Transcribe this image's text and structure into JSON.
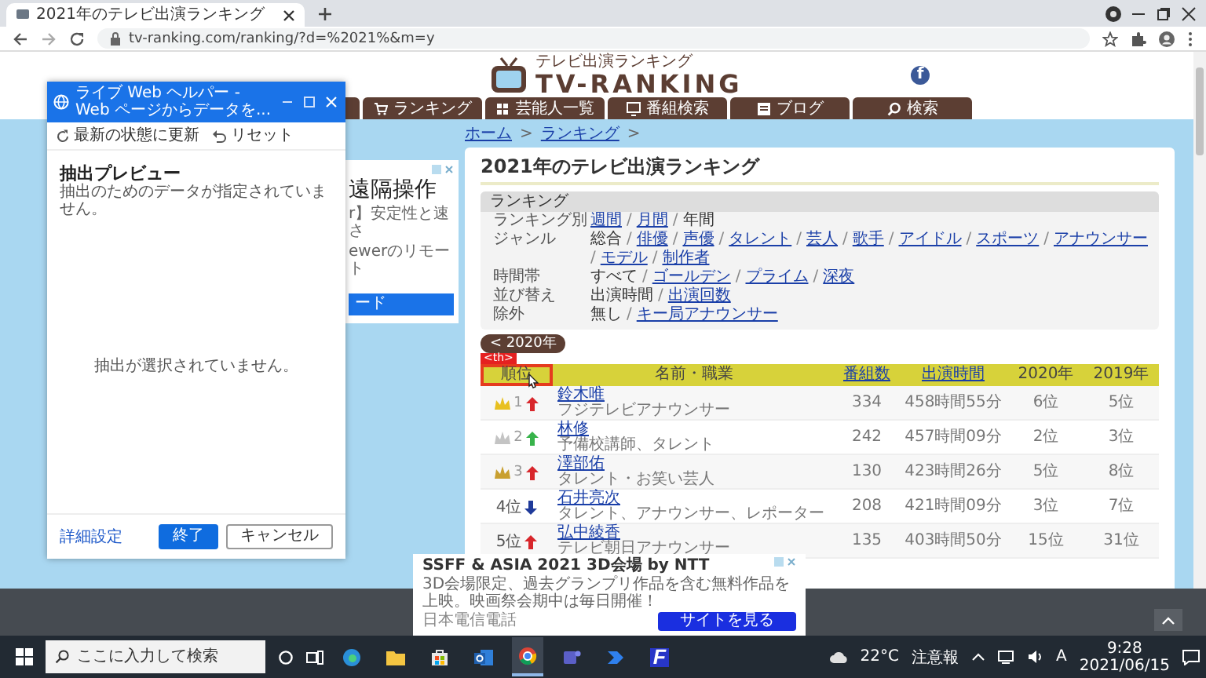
{
  "browser": {
    "tab_title": "2021年のテレビ出演ランキング",
    "url": "tv-ranking.com/ranking/?d=%2021%&m=y"
  },
  "header": {
    "tagline": "テレビ出演ランキング",
    "logo": "TV-RANKING",
    "social": "f"
  },
  "nav": [
    {
      "label": "ランキング",
      "kind": "cart"
    },
    {
      "label": "芸能人一覧",
      "kind": "list"
    },
    {
      "label": "番組検索",
      "kind": "monitor"
    },
    {
      "label": "ブログ",
      "kind": "book"
    },
    {
      "label": "検索",
      "kind": "search"
    }
  ],
  "side_ad": {
    "headline": "遠隔操作",
    "lines": [
      "r】安定性と速さ",
      "ewerのリモート"
    ],
    "button": "ード"
  },
  "breadcrumb": [
    {
      "text": "ホーム",
      "kind": "link"
    },
    {
      "text": ">",
      "kind": "sep"
    },
    {
      "text": "ランキング",
      "kind": "link"
    },
    {
      "text": ">",
      "kind": "sep"
    }
  ],
  "page_title": "2021年のテレビ出演ランキング",
  "filters": {
    "title": "ランキング",
    "rows": [
      {
        "label": "ランキング別",
        "options": [
          {
            "label": "週間",
            "selected": false,
            "sep": "/"
          },
          {
            "label": "月間",
            "selected": false,
            "sep": "/"
          },
          {
            "label": "年間",
            "selected": true
          }
        ]
      },
      {
        "label": "ジャンル",
        "options": [
          {
            "label": "総合",
            "selected": true,
            "sep": "/"
          },
          {
            "label": "俳優",
            "selected": false,
            "sep": "/"
          },
          {
            "label": "声優",
            "selected": false,
            "sep": "/"
          },
          {
            "label": "タレント",
            "selected": false,
            "sep": "/"
          },
          {
            "label": "芸人",
            "selected": false,
            "sep": "/"
          },
          {
            "label": "歌手",
            "selected": false,
            "sep": "/"
          },
          {
            "label": "アイドル",
            "selected": false,
            "sep": "/"
          },
          {
            "label": "スポーツ",
            "selected": false,
            "sep": "/"
          },
          {
            "label": "アナウンサー",
            "selected": false,
            "sep": "/"
          },
          {
            "label": "モデル",
            "selected": false,
            "sep": "/"
          },
          {
            "label": "制作者",
            "selected": false
          }
        ]
      },
      {
        "label": "時間帯",
        "options": [
          {
            "label": "すべて",
            "selected": true,
            "sep": "/"
          },
          {
            "label": "ゴールデン",
            "selected": false,
            "sep": "/"
          },
          {
            "label": "プライム",
            "selected": false,
            "sep": "/"
          },
          {
            "label": "深夜",
            "selected": false
          }
        ]
      },
      {
        "label": "並び替え",
        "options": [
          {
            "label": "出演時間",
            "selected": true,
            "sep": "/"
          },
          {
            "label": "出演回数",
            "selected": false
          }
        ]
      },
      {
        "label": "除外",
        "options": [
          {
            "label": "無し",
            "selected": true,
            "sep": "/"
          },
          {
            "label": "キー局アナウンサー",
            "selected": false
          }
        ]
      }
    ]
  },
  "prev_year_button": "< 2020年",
  "table": {
    "tag_label": "<th>",
    "columns": [
      {
        "label": "順位",
        "sortable": false,
        "highlighted": true
      },
      {
        "label": "名前・職業",
        "sortable": false,
        "highlighted": false
      },
      {
        "label": "番組数",
        "sortable": true,
        "highlighted": false
      },
      {
        "label": "出演時間",
        "sortable": true,
        "highlighted": false
      },
      {
        "label": "2020年",
        "sortable": false,
        "highlighted": false
      },
      {
        "label": "2019年",
        "sortable": false,
        "highlighted": false
      }
    ],
    "rows": [
      {
        "rank": {
          "kind": "crown",
          "text": "1",
          "color": "#e8c020",
          "arrow": {
            "kind": "up"
          }
        },
        "person": {
          "name": "鈴木唯",
          "occupation": "フジテレビアナウンサー"
        },
        "programs": "334",
        "time": "458時間55分",
        "year_2020": "6位",
        "year_2019": "5位"
      },
      {
        "rank": {
          "kind": "crown",
          "text": "2",
          "color": "#c4c4c4",
          "arrow": {
            "kind": "stay"
          }
        },
        "person": {
          "name": "林修",
          "occupation": "予備校講師、タレント"
        },
        "programs": "242",
        "time": "457時間09分",
        "year_2020": "2位",
        "year_2019": "3位"
      },
      {
        "rank": {
          "kind": "crown",
          "text": "3",
          "color": "#c9a030",
          "arrow": {
            "kind": "up"
          }
        },
        "person": {
          "name": "澤部佑",
          "occupation": "タレント・お笑い芸人"
        },
        "programs": "130",
        "time": "423時間26分",
        "year_2020": "5位",
        "year_2019": "8位"
      },
      {
        "rank": {
          "kind": "text",
          "text": "4位",
          "arrow": {
            "kind": "down"
          }
        },
        "person": {
          "name": "石井亮次",
          "occupation": "タレント、アナウンサー、レポーター"
        },
        "programs": "208",
        "time": "421時間09分",
        "year_2020": "3位",
        "year_2019": "7位"
      },
      {
        "rank": {
          "kind": "text",
          "text": "5位",
          "arrow": {
            "kind": "up"
          }
        },
        "person": {
          "name": "弘中綾香",
          "occupation": "テレビ朝日アナウンサー"
        },
        "programs": "135",
        "time": "403時間50分",
        "year_2020": "15位",
        "year_2019": "31位"
      }
    ]
  },
  "footer_ad": {
    "title": "SSFF & ASIA 2021 3D会場 by NTT",
    "text": "3D会場限定、過去グランプリ作品を含む無料作品を上映。映画祭会期中は毎日開催！",
    "advertiser": "日本電信電話",
    "button": "サイトを見る"
  },
  "dialog": {
    "title": "ライブ Web ヘルパー - Web ページからデータを...",
    "toolbar": [
      {
        "label": "最新の状態に更新",
        "kind": "refresh"
      },
      {
        "label": "リセット",
        "kind": "undo"
      }
    ],
    "heading": "抽出プレビュー",
    "subtitle": "抽出のためのデータが指定されていません。",
    "empty_message": "抽出が選択されていません。",
    "link": "詳細設定",
    "buttons": [
      {
        "label": "終了",
        "kind": "primary"
      },
      {
        "label": "キャンセル",
        "kind": "secondary"
      }
    ]
  },
  "taskbar": {
    "search_placeholder": "ここに入力して検索",
    "apps": [
      {
        "kind": "edge",
        "selected": false
      },
      {
        "kind": "folder",
        "selected": false
      },
      {
        "kind": "store",
        "selected": false
      },
      {
        "kind": "mail",
        "selected": false
      },
      {
        "kind": "chrome",
        "selected": true
      },
      {
        "kind": "teams",
        "selected": false
      },
      {
        "kind": "automate",
        "selected": false
      },
      {
        "kind": "letter",
        "letter": "F",
        "selected": false
      }
    ],
    "temperature": "22°C",
    "alert": "注意報",
    "ime": "A",
    "time": "9:28",
    "date": "2021/06/15"
  }
}
